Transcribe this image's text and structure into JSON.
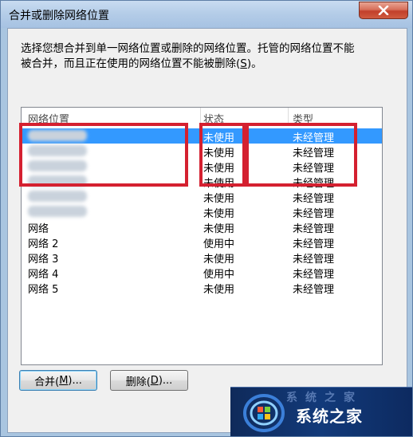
{
  "window": {
    "title": "合并或删除网络位置"
  },
  "instructions": {
    "line1": "选择您想合并到单一网络位置或删除的网络位置。托管的网络位置不能",
    "line2_prefix": "被合并，而且正在使用的网络位置不能被删除(",
    "line2_accel": "S",
    "line2_suffix": ")。"
  },
  "list": {
    "headers": {
      "name": "网络位置",
      "status": "状态",
      "type": "类型"
    },
    "rows": [
      {
        "name": "",
        "status": "未使用",
        "type": "未经管理",
        "selected": true
      },
      {
        "name": "",
        "status": "未使用",
        "type": "未经管理",
        "selected": false
      },
      {
        "name": "",
        "status": "未使用",
        "type": "未经管理",
        "selected": false
      },
      {
        "name": "",
        "status": "未使用",
        "type": "未经管理",
        "selected": false
      },
      {
        "name": "",
        "status": "未使用",
        "type": "未经管理",
        "selected": false
      },
      {
        "name": "",
        "status": "未使用",
        "type": "未经管理",
        "selected": false
      },
      {
        "name": "网络",
        "status": "未使用",
        "type": "未经管理",
        "selected": false
      },
      {
        "name": "网络  2",
        "status": "使用中",
        "type": "未经管理",
        "selected": false
      },
      {
        "name": "网络  3",
        "status": "未使用",
        "type": "未经管理",
        "selected": false
      },
      {
        "name": "网络  4",
        "status": "使用中",
        "type": "未经管理",
        "selected": false
      },
      {
        "name": "网络  5",
        "status": "未使用",
        "type": "未经管理",
        "selected": false
      }
    ]
  },
  "buttons": {
    "merge_prefix": "合并(",
    "merge_accel": "M",
    "merge_suffix": ")...",
    "delete_prefix": "删除(",
    "delete_accel": "D",
    "delete_suffix": ")..."
  },
  "watermark": {
    "text": "系统之家",
    "deco": "系统之家"
  },
  "colors": {
    "highlight_box": "#d42030",
    "selection": "#3399ff",
    "close_button": "#c2402b"
  },
  "icons": {
    "close": "close-x-icon",
    "logo": "windows-logo-icon"
  }
}
